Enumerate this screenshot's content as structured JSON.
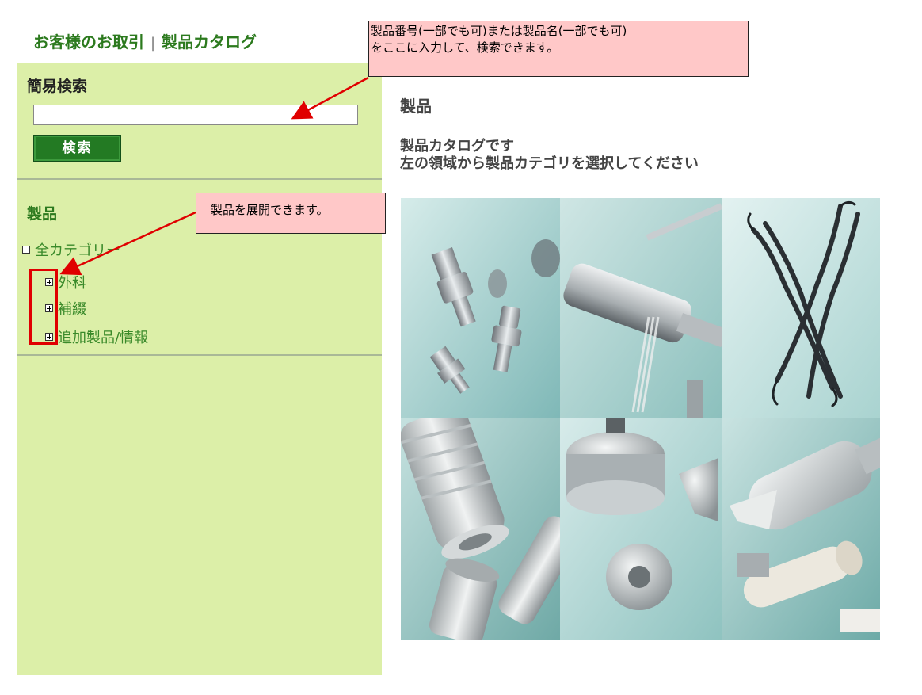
{
  "breadcrumb": {
    "part1": "お客様のお取引",
    "separator": "|",
    "part2": "製品カタログ"
  },
  "sidebar": {
    "search_title": "簡易検索",
    "search_input": {
      "value": "",
      "placeholder": ""
    },
    "search_button": "検索",
    "products_title": "製品",
    "tree": [
      {
        "label": "全カテゴリー",
        "state": "expanded"
      },
      {
        "label": "外科",
        "state": "collapsed"
      },
      {
        "label": "補綴",
        "state": "collapsed"
      },
      {
        "label": "追加製品/情報",
        "state": "collapsed"
      }
    ]
  },
  "main": {
    "title": "製品",
    "desc_line1": "製品カタログです",
    "desc_line2": "左の領域から製品カテゴリを選択してください"
  },
  "callouts": {
    "search_line1": "製品番号(一部でも可)または製品名(一部でも可)",
    "search_line2": "をここに入力して、検索できます。",
    "tree": "製品を展開できます。"
  },
  "gallery_images": [
    {
      "icon": "abutment-parts-image"
    },
    {
      "icon": "instrument-drill-image"
    },
    {
      "icon": "periodontal-probes-image"
    },
    {
      "icon": "implant-screws-image"
    },
    {
      "icon": "healing-caps-image"
    },
    {
      "icon": "impression-copings-image"
    }
  ],
  "colors": {
    "sidebar_bg": "#dcefa8",
    "accent_green": "#2c7a1e",
    "button_green": "#237a23",
    "callout_bg": "#ffc8c8",
    "annotation_red": "#e00000"
  }
}
